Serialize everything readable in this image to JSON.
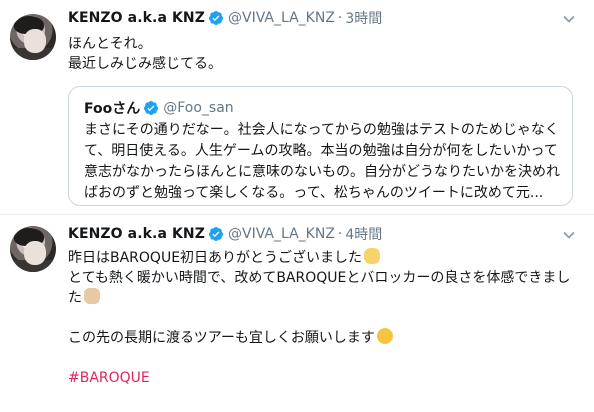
{
  "tweets": [
    {
      "name": "KENZO a.k.a KNZ",
      "handle": "@VIVA_LA_KNZ",
      "separator": "·",
      "time": "3時間",
      "lines": [
        "ほんとそれ。",
        "最近しみじみ感じてる。"
      ],
      "quote": {
        "name": "Fooさん",
        "handle": "@Foo_san",
        "lines": [
          "まさにその通りだなー。社会人になってからの勉強はテストのためじゃなく",
          "て、明日使える。人生ゲームの攻略。本当の勉強は自分が何をしたいかって",
          "意志がなかったらほんとに意味のないもの。自分がどうなりたいかを決めれ",
          "ばおのずと勉強って楽しくなる。って、松ちゃんのツイートに改めて元..."
        ]
      }
    },
    {
      "name": "KENZO a.k.a KNZ",
      "handle": "@VIVA_LA_KNZ",
      "separator": "·",
      "time": "4時間",
      "lines": [
        "昨日はBAROQUE初日ありがとうございました",
        "とても熱く暖かい時間で、改めてBAROQUEとバロッカーの良さを体感できまし",
        "た",
        "",
        "この先の長期に渡るツアーも宜しくお願いします",
        "",
        "#BAROQUE"
      ],
      "emojis": [
        "raised-hands-emoji",
        "thumbs-up-emoji",
        "relieved-face-emoji"
      ]
    }
  ],
  "colors": {
    "accent": "#1da1f2",
    "hashtag": "#e0245e",
    "muted": "#657786",
    "border": "#e6ecf0"
  },
  "icons": [
    "verified-badge-icon",
    "chevron-down-icon"
  ]
}
